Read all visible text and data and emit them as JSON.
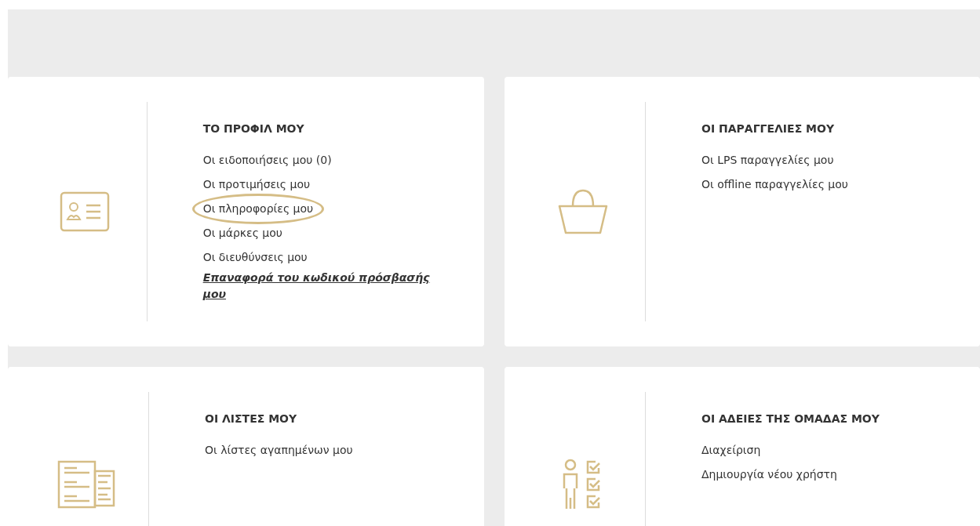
{
  "sections": [
    {
      "kind": "id-card",
      "title": "ΤΟ ΠΡΟΦΙΛ ΜΟΥ",
      "links": [
        {
          "label": "Οι ειδοποιήσεις μου (0)",
          "kind": "plain",
          "highlighted": false
        },
        {
          "label": "Οι προτιμήσεις μου",
          "kind": "plain",
          "highlighted": false
        },
        {
          "label": "Οι πληροφορίες μου",
          "kind": "plain",
          "highlighted": true
        },
        {
          "label": "Οι μάρκες μου",
          "kind": "plain",
          "highlighted": false
        },
        {
          "label": "Οι διευθύνσεις μου",
          "kind": "plain",
          "highlighted": false
        },
        {
          "label": "Επαναφορά του κωδικού πρόσβασής μου",
          "kind": "emphasis",
          "highlighted": false
        }
      ]
    },
    {
      "kind": "basket",
      "title": "ΟΙ ΠΑΡΑΓΓΕΛΙΕΣ ΜΟΥ",
      "links": [
        {
          "label": "Οι LPS παραγγελίες μου",
          "kind": "plain",
          "highlighted": false
        },
        {
          "label": "Οι offline παραγγελίες μου",
          "kind": "plain",
          "highlighted": false
        }
      ]
    },
    {
      "kind": "documents",
      "title": "ΟΙ ΛΙΣΤΕΣ ΜΟΥ",
      "links": [
        {
          "label": "Οι λίστες αγαπημένων μου",
          "kind": "plain",
          "highlighted": false
        }
      ]
    },
    {
      "kind": "person-checklist",
      "title": "ΟΙ ΑΔΕΙΕΣ ΤΗΣ ΟΜΑΔΑΣ ΜΟΥ",
      "links": [
        {
          "label": "Διαχείριση",
          "kind": "plain",
          "highlighted": false
        },
        {
          "label": "Δημιουργία νέου χρήστη",
          "kind": "plain",
          "highlighted": false
        }
      ]
    }
  ]
}
